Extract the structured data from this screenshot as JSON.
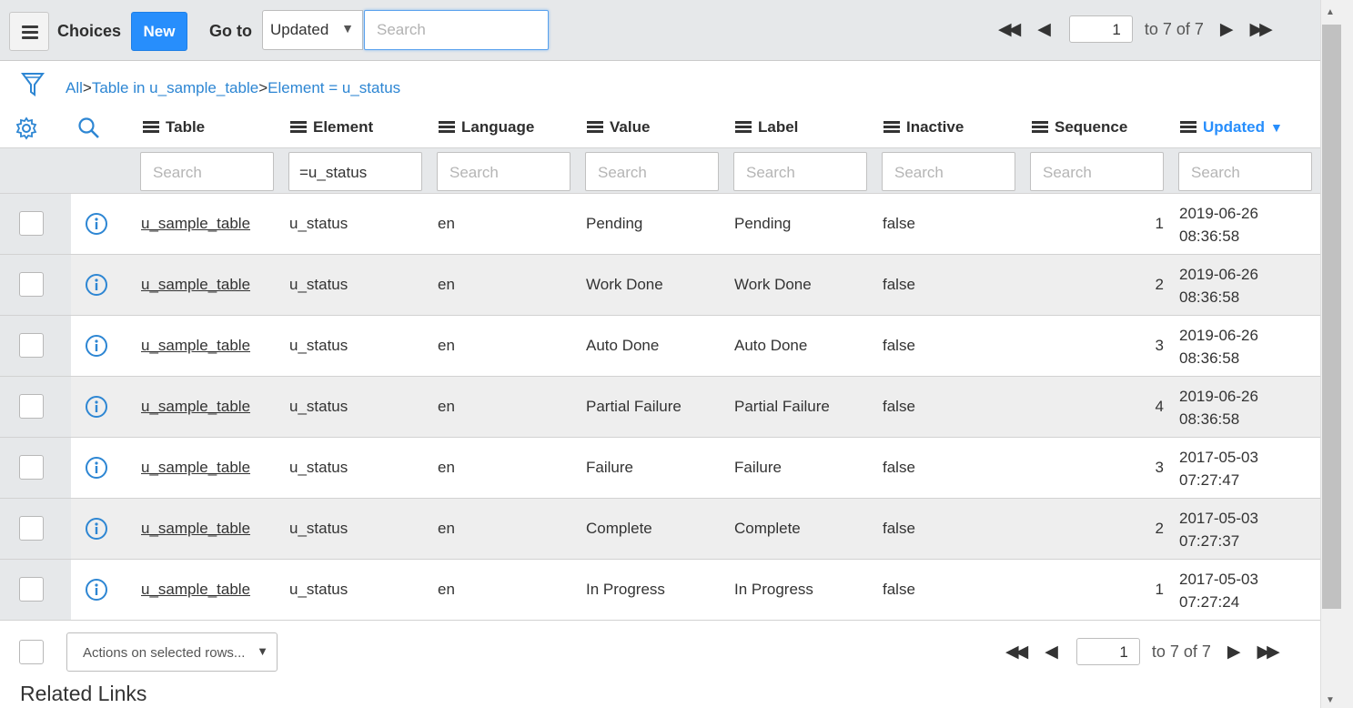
{
  "header": {
    "menu_icon": "hamburger-icon",
    "title": "Choices",
    "new_label": "New",
    "goto_label": "Go to",
    "goto_field": "Updated",
    "search_placeholder": "Search"
  },
  "pager_top": {
    "page": "1",
    "range": "to 7 of 7"
  },
  "pager_bottom": {
    "page": "1",
    "range": "to 7 of 7"
  },
  "breadcrumb": {
    "all": "All",
    "sep": ">",
    "crumb1": "Table in u_sample_table",
    "crumb2": "Element = u_status"
  },
  "columns": [
    {
      "label": "Table"
    },
    {
      "label": "Element"
    },
    {
      "label": "Language"
    },
    {
      "label": "Value"
    },
    {
      "label": "Label"
    },
    {
      "label": "Inactive"
    },
    {
      "label": "Sequence"
    },
    {
      "label": "Updated",
      "sorted": "descending"
    }
  ],
  "filters": {
    "placeholder": "Search",
    "element_value": "=u_status"
  },
  "rows": [
    {
      "table": "u_sample_table",
      "element": "u_status",
      "language": "en",
      "value": "Pending",
      "label": "Pending",
      "inactive": "false",
      "sequence": "1",
      "updated_date": "2019-06-26",
      "updated_time": "08:36:58"
    },
    {
      "table": "u_sample_table",
      "element": "u_status",
      "language": "en",
      "value": "Work Done",
      "label": "Work Done",
      "inactive": "false",
      "sequence": "2",
      "updated_date": "2019-06-26",
      "updated_time": "08:36:58"
    },
    {
      "table": "u_sample_table",
      "element": "u_status",
      "language": "en",
      "value": "Auto Done",
      "label": "Auto Done",
      "inactive": "false",
      "sequence": "3",
      "updated_date": "2019-06-26",
      "updated_time": "08:36:58"
    },
    {
      "table": "u_sample_table",
      "element": "u_status",
      "language": "en",
      "value": "Partial Failure",
      "label": "Partial Failure",
      "inactive": "false",
      "sequence": "4",
      "updated_date": "2019-06-26",
      "updated_time": "08:36:58"
    },
    {
      "table": "u_sample_table",
      "element": "u_status",
      "language": "en",
      "value": "Failure",
      "label": "Failure",
      "inactive": "false",
      "sequence": "3",
      "updated_date": "2017-05-03",
      "updated_time": "07:27:47"
    },
    {
      "table": "u_sample_table",
      "element": "u_status",
      "language": "en",
      "value": "Complete",
      "label": "Complete",
      "inactive": "false",
      "sequence": "2",
      "updated_date": "2017-05-03",
      "updated_time": "07:27:37"
    },
    {
      "table": "u_sample_table",
      "element": "u_status",
      "language": "en",
      "value": "In Progress",
      "label": "In Progress",
      "inactive": "false",
      "sequence": "1",
      "updated_date": "2017-05-03",
      "updated_time": "07:27:24"
    }
  ],
  "footer": {
    "actions_label": "Actions on selected rows...",
    "related_links": "Related Links"
  },
  "colors": {
    "accent": "#278efc",
    "link": "#2d86d3",
    "header_bg": "#e6e8ea"
  }
}
